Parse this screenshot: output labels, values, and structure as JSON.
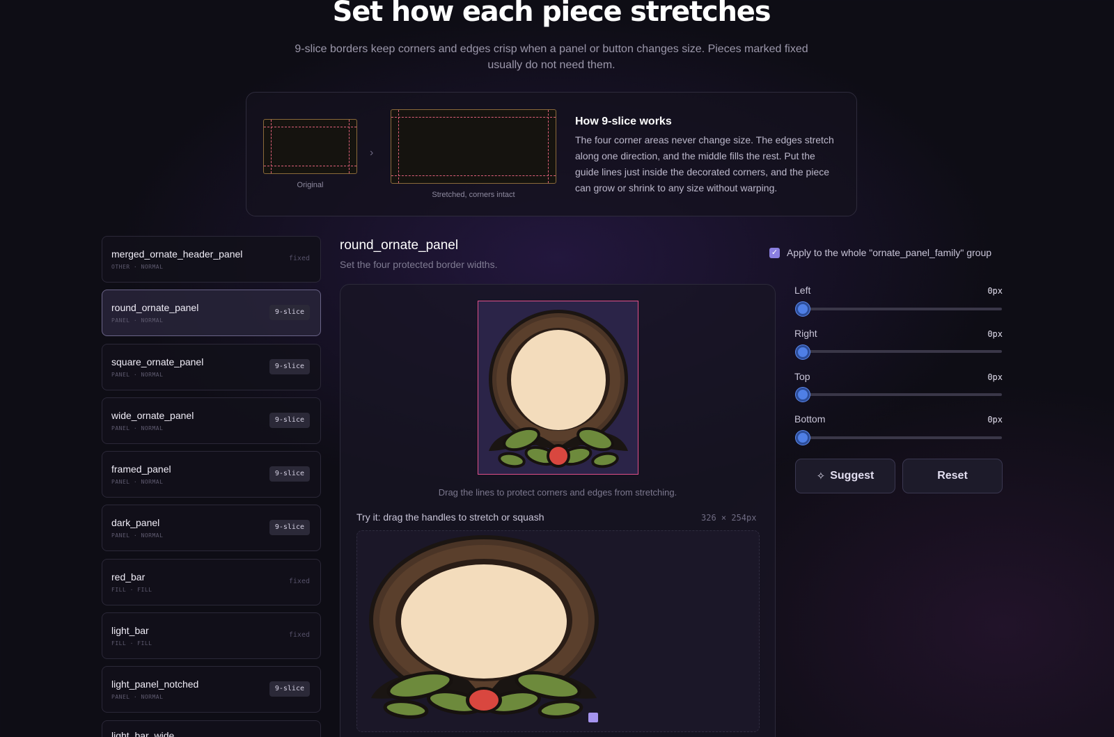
{
  "header": {
    "title": "Set how each piece stretches",
    "subtitle": "9-slice borders keep corners and edges crisp when a panel or button changes size. Pieces marked fixed usually do not need them."
  },
  "info_card": {
    "original_caption": "Original",
    "stretched_caption": "Stretched, corners intact",
    "title": "How 9-slice works",
    "body": "The four corner areas never change size. The edges stretch along one direction, and the middle fills the rest. Put the guide lines just inside the decorated corners, and the piece can grow or shrink to any size without warping.",
    "arrow_icon": "chevron-right-icon"
  },
  "pieces": [
    {
      "name": "merged_ornate_header_panel",
      "meta": "OTHER · NORMAL",
      "tag": "fixed",
      "kind": "fixed"
    },
    {
      "name": "round_ornate_panel",
      "meta": "PANEL · NORMAL",
      "tag": "9-slice",
      "kind": "badge",
      "active": true
    },
    {
      "name": "square_ornate_panel",
      "meta": "PANEL · NORMAL",
      "tag": "9-slice",
      "kind": "badge"
    },
    {
      "name": "wide_ornate_panel",
      "meta": "PANEL · NORMAL",
      "tag": "9-slice",
      "kind": "badge"
    },
    {
      "name": "framed_panel",
      "meta": "PANEL · NORMAL",
      "tag": "9-slice",
      "kind": "badge"
    },
    {
      "name": "dark_panel",
      "meta": "PANEL · NORMAL",
      "tag": "9-slice",
      "kind": "badge"
    },
    {
      "name": "red_bar",
      "meta": "FILL · FILL",
      "tag": "fixed",
      "kind": "fixed"
    },
    {
      "name": "light_bar",
      "meta": "FILL · FILL",
      "tag": "fixed",
      "kind": "fixed"
    },
    {
      "name": "light_panel_notched",
      "meta": "PANEL · NORMAL",
      "tag": "9-slice",
      "kind": "badge"
    },
    {
      "name": "light_bar_wide",
      "meta": "",
      "tag": "",
      "kind": "none"
    }
  ],
  "editor": {
    "title": "round_ornate_panel",
    "subtitle": "Set the four protected border widths.",
    "apply_label": "Apply to the whole \"ornate_panel_family\" group",
    "apply_checked": true,
    "drag_hint": "Drag the lines to protect corners and edges from stretching.",
    "try_label": "Try it: drag the handles to stretch or squash",
    "dims": "326 × 254px"
  },
  "sliders": [
    {
      "label": "Left",
      "value": "0px",
      "level": 0
    },
    {
      "label": "Right",
      "value": "0px",
      "level": 0
    },
    {
      "label": "Top",
      "value": "0px",
      "level": 0
    },
    {
      "label": "Bottom",
      "value": "0px",
      "level": 0
    }
  ],
  "buttons": {
    "suggest": "Suggest",
    "suggest_icon": "sparkle-icon",
    "reset": "Reset"
  },
  "colors": {
    "accent": "#8a7fe0",
    "slider_thumb": "#4f7fe6",
    "guide_line": "#e0508a",
    "frame_brown": "#4a3426",
    "parchment": "#f3dcbc",
    "leaf_green": "#6d8a3c",
    "berry_red": "#d9473f"
  }
}
